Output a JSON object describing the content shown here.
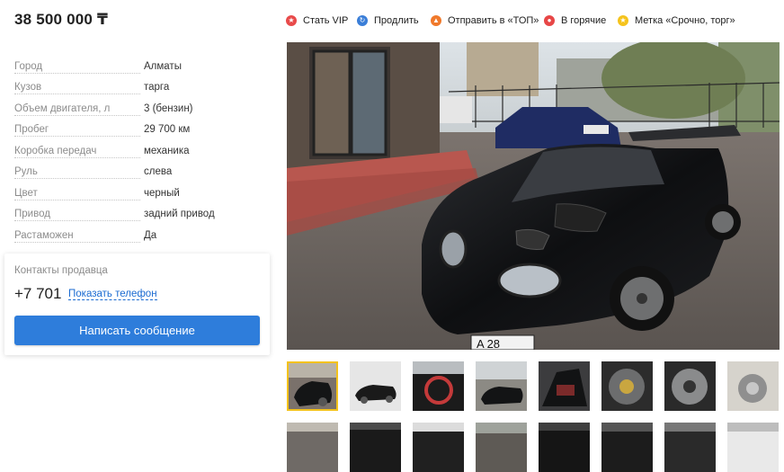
{
  "listing": {
    "price": "38 500 000 ₸"
  },
  "specs": [
    {
      "name": "Город",
      "value": "Алматы"
    },
    {
      "name": "Кузов",
      "value": "тарга"
    },
    {
      "name": "Объем двигателя, л",
      "value": "3 (бензин)"
    },
    {
      "name": "Пробег",
      "value": "29 700 км"
    },
    {
      "name": "Коробка передач",
      "value": "механика"
    },
    {
      "name": "Руль",
      "value": "слева"
    },
    {
      "name": "Цвет",
      "value": "черный"
    },
    {
      "name": "Привод",
      "value": "задний привод"
    },
    {
      "name": "Растаможен",
      "value": "Да"
    }
  ],
  "contact": {
    "title": "Контакты продавца",
    "phone": "+7 701",
    "show_phone_label": "Показать телефон",
    "message_button_label": "Написать сообщение"
  },
  "promo": {
    "items": [
      {
        "label": "Стать VIP",
        "icon": "trophy-icon",
        "color": "#e84a4a"
      },
      {
        "label": "Продлить",
        "icon": "refresh-icon",
        "color": "#3a7ed8"
      },
      {
        "label": "Отправить в «ТОП»",
        "icon": "arrow-up-icon",
        "color": "#f0792b"
      },
      {
        "label": "В горячие",
        "icon": "fire-icon",
        "color": "#e74646"
      },
      {
        "label": "Метка «Срочно, торг»",
        "icon": "star-icon",
        "color": "#f5c31c"
      }
    ]
  },
  "photo": {
    "plate_text": "A 28"
  },
  "thumbnails": {
    "selected_index": 0,
    "count_visible": 16
  },
  "colors": {
    "accent": "#2e7ddb",
    "link": "#1b6bd1",
    "thumb_selected": "#f3c21b"
  }
}
